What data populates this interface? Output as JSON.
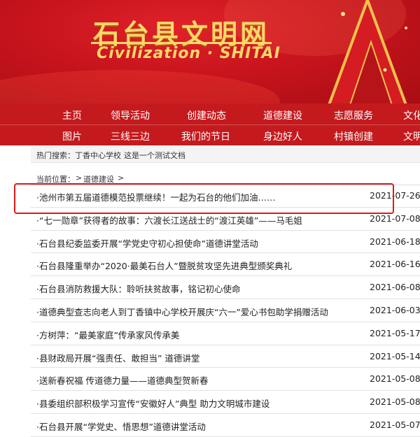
{
  "site": {
    "title_cn": "石台县文明网",
    "title_en": "Civilization · SHITAI"
  },
  "nav": {
    "row1": [
      "主页",
      "领导活动",
      "创建动态",
      "道德建设",
      "志愿服务",
      "文化"
    ],
    "row2": [
      "图片",
      "三线三边",
      "我们的节日",
      "身边好人",
      "村镇创建",
      "文明"
    ]
  },
  "hot_search": {
    "label": "热门搜索：",
    "items": [
      "丁香中心学校",
      "这是一个测试文档"
    ]
  },
  "breadcrumb": {
    "label": "当前位置：",
    "sep1": ">",
    "current": "道德建设",
    "sep2": ">"
  },
  "articles": [
    {
      "title": "·池州市第五届道德模范投票继续！一起为石台的他们加油……",
      "date": "2021-07-26"
    },
    {
      "title": "·“七一勋章”获得者的故事：六渡长江送战士的“渡江英雄”——马毛姐",
      "date": "2021-07-08"
    },
    {
      "title": "·石台县纪委监委开展“学党史守初心担使命”道德讲堂活动",
      "date": "2021-06-18"
    },
    {
      "title": "·石台县隆重举办“2020·最美石台人”暨脱贫攻坚先进典型颁奖典礼",
      "date": "2021-06-16"
    },
    {
      "title": "·石台县消防救援大队：聆听扶贫故事，铭记初心使命",
      "date": "2021-06-08"
    },
    {
      "title": "·道德典型查志向老人到丁香镇中心学校开展庆“六一”爱心书包助学捐赠活动",
      "date": "2021-06-03"
    },
    {
      "title": "·方树萍：“最美家庭”传承家风传承美",
      "date": "2021-05-17"
    },
    {
      "title": "·县财政局开展“强责任、敢担当” 道德讲堂",
      "date": "2021-05-14"
    },
    {
      "title": "·送新春祝福 传道德力量——道德典型贺新春",
      "date": "2021-05-08"
    },
    {
      "title": "·县委组织部积极学习宣传“安徽好人”典型 助力文明城市建设",
      "date": "2021-05-08"
    },
    {
      "title": "·石台县开展“学党史、悟思想”道德讲堂活动",
      "date": "2021-05-07"
    }
  ],
  "colors": {
    "banner_red": "#c8141d",
    "nav_red": "#c41a1e",
    "gold": "#ffd86a",
    "highlight_box": "#e01818"
  }
}
